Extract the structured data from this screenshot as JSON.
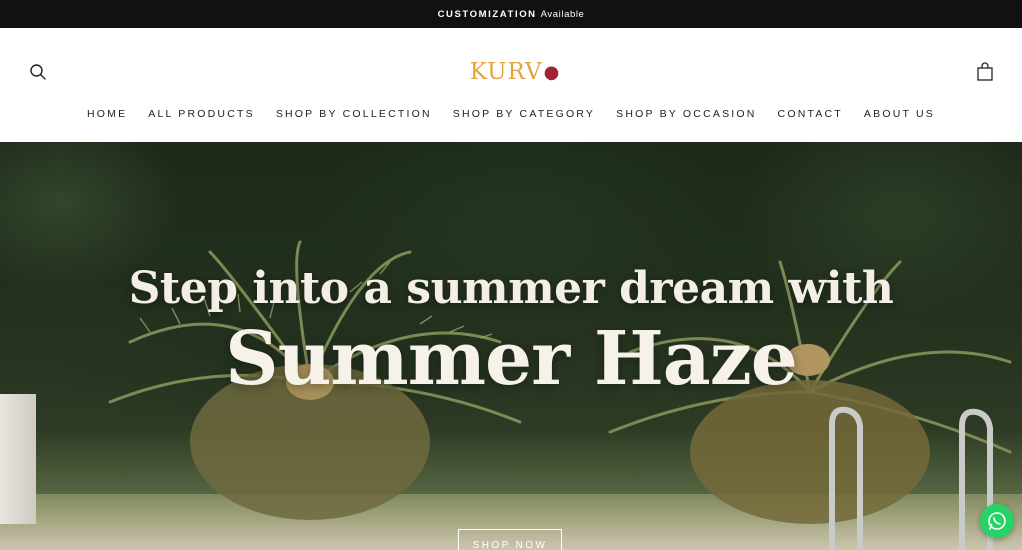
{
  "announcement": {
    "bold": "CUSTOMIZATION",
    "rest": "Available"
  },
  "header": {
    "logo": {
      "text": "KURV",
      "mark": "●"
    },
    "icons": {
      "search": "search-icon",
      "cart": "shopping-bag-icon"
    }
  },
  "nav": {
    "items": [
      {
        "label": "HOME"
      },
      {
        "label": "ALL PRODUCTS"
      },
      {
        "label": "SHOP BY COLLECTION"
      },
      {
        "label": "SHOP BY CATEGORY"
      },
      {
        "label": "SHOP BY OCCASION"
      },
      {
        "label": "CONTACT"
      },
      {
        "label": "ABOUT US"
      }
    ]
  },
  "hero": {
    "line1": "Step into a summer dream with",
    "line2": "Summer Haze",
    "cta": "SHOP NOW"
  },
  "colors": {
    "announcement_bg": "#111111",
    "logo_gold": "#e4a43a",
    "logo_mark": "#a3222f",
    "whatsapp": "#25d366"
  }
}
